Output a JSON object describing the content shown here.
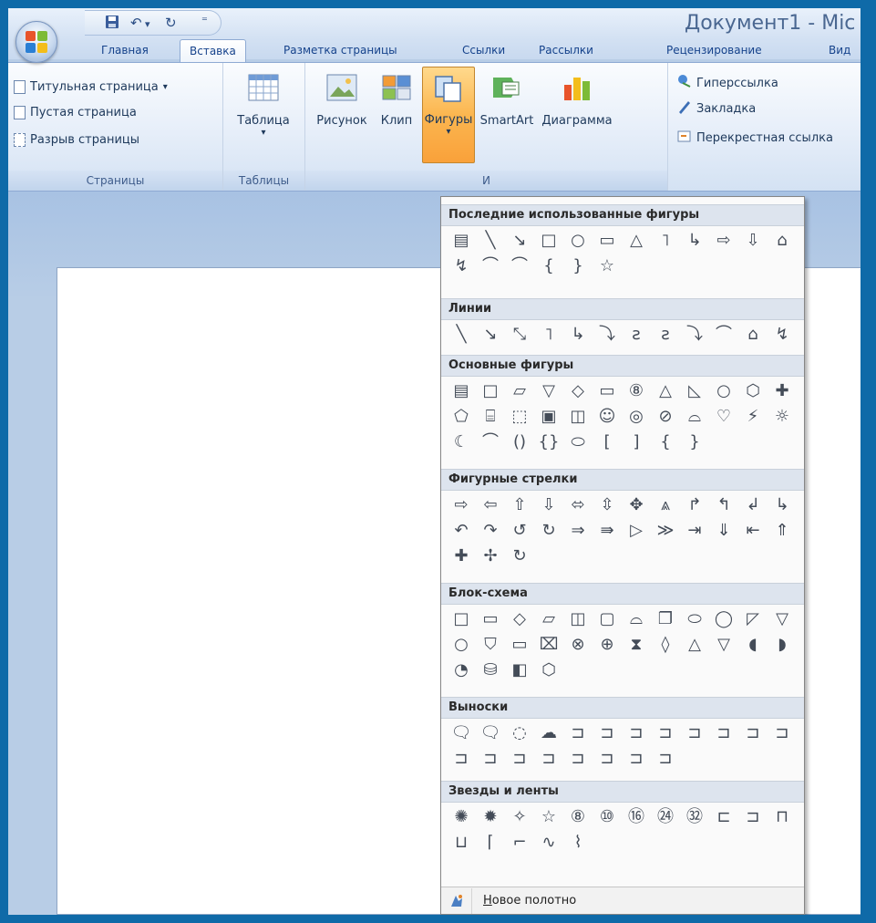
{
  "window": {
    "title": "Документ1 - Mic"
  },
  "quick_access": {
    "save_icon": "save-icon",
    "undo_symbol": "↶",
    "undo_arrow": "▾",
    "redo_symbol": "↻",
    "customize_symbol": "⁼"
  },
  "tabs": [
    {
      "label": "Главная"
    },
    {
      "label": "Вставка"
    },
    {
      "label": "Разметка страницы"
    },
    {
      "label": "Ссылки"
    },
    {
      "label": "Рассылки"
    },
    {
      "label": "Рецензирование"
    },
    {
      "label": "Вид"
    }
  ],
  "ribbon": {
    "pages_group": {
      "label": "Страницы",
      "items": [
        {
          "label": "Титульная страница",
          "arrow": "▾"
        },
        {
          "label": "Пустая страница"
        },
        {
          "label": "Разрыв страницы"
        }
      ]
    },
    "tables_group": {
      "label": "Таблицы",
      "table_button": "Таблица",
      "table_arrow": "▾"
    },
    "illustrations_group": {
      "label": "И",
      "picture_button": "Рисунок",
      "clip_button": "Клип",
      "shapes_button": "Фигуры",
      "shapes_arrow": "▾",
      "smartart_button": "SmartArt",
      "chart_button": "Диаграмма"
    },
    "links_group": {
      "items": [
        {
          "label": "Гиперссылка"
        },
        {
          "label": "Закладка"
        },
        {
          "label": "Перекрестная ссылка"
        }
      ]
    }
  },
  "shapes_panel": {
    "categories": [
      {
        "title": "Последние использованные фигуры",
        "shapes": [
          "▤",
          "╲",
          "↘",
          "□",
          "○",
          "▭",
          "△",
          "˥",
          "↳",
          "⇨",
          "⇩",
          "⌂",
          "↯",
          "⌒",
          "⌒",
          "{",
          "}",
          "☆"
        ]
      },
      {
        "title": "Линии",
        "shapes": [
          "╲",
          "↘",
          "⤡",
          "˥",
          "↳",
          "⤵",
          "ƨ",
          "ƨ",
          "⤵",
          "⌒",
          "⌂",
          "↯"
        ]
      },
      {
        "title": "Основные фигуры",
        "shapes": [
          "▤",
          "□",
          "▱",
          "▽",
          "◇",
          "▭",
          "⑧",
          "△",
          "◺",
          "○",
          "⬡",
          "✚",
          "⬠",
          "⌸",
          "⬚",
          "▣",
          "◫",
          "☺",
          "◎",
          "⊘",
          "⌓",
          "♡",
          "⚡",
          "☼",
          "☾",
          "⌒",
          "()",
          "{}",
          "⬭",
          "[",
          "]",
          "{",
          "}"
        ]
      },
      {
        "title": "Фигурные стрелки",
        "shapes": [
          "⇨",
          "⇦",
          "⇧",
          "⇩",
          "⬄",
          "⇳",
          "✥",
          "⩓",
          "↱",
          "↰",
          "↲",
          "↳",
          "↶",
          "↷",
          "↺",
          "↻",
          "⇒",
          "⇛",
          "▷",
          "≫",
          "⇥",
          "⇓",
          "⇤",
          "⇑",
          "✚",
          "✢",
          "↻"
        ]
      },
      {
        "title": "Блок-схема",
        "shapes": [
          "□",
          "▭",
          "◇",
          "▱",
          "◫",
          "▢",
          "⌓",
          "❐",
          "⬭",
          "◯",
          "◸",
          "▽",
          "○",
          "⛉",
          "▭",
          "⌧",
          "⊗",
          "⊕",
          "⧗",
          "◊",
          "△",
          "▽",
          "◖",
          "◗",
          "◔",
          "⛁",
          "◧",
          "⬡"
        ]
      },
      {
        "title": "Выноски",
        "shapes": [
          "🗨",
          "🗨",
          "◌",
          "☁",
          "⊐",
          "⊐",
          "⊐",
          "⊐",
          "⊐",
          "⊐",
          "⊐",
          "⊐",
          "⊐",
          "⊐",
          "⊐",
          "⊐",
          "⊐",
          "⊐",
          "⊐",
          "⊐"
        ]
      },
      {
        "title": "Звезды и ленты",
        "shapes": [
          "✺",
          "✹",
          "✧",
          "☆",
          "⑧",
          "⑩",
          "⑯",
          "㉔",
          "㉜",
          "⊏",
          "⊐",
          "⊓",
          "⊔",
          "⌈",
          "⌐",
          "∿",
          "⌇"
        ]
      }
    ],
    "footer_icon": "new-canvas-icon",
    "footer_label_hotkey": "Н",
    "footer_label_rest": "овое полотно"
  },
  "colors": {
    "accent_orange": "#fbb650",
    "ribbon_blue": "#15428b",
    "frame_blue": "#0f6aa8"
  }
}
